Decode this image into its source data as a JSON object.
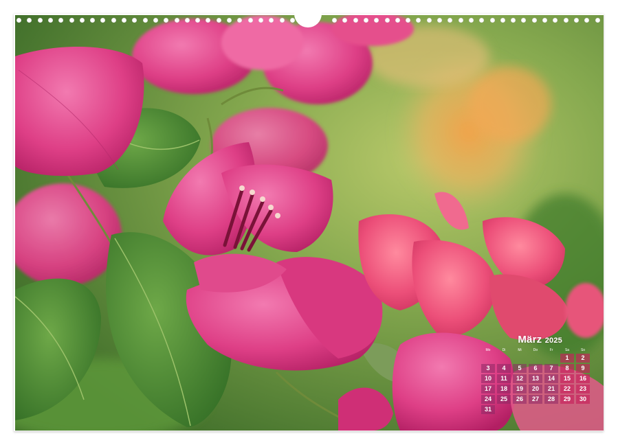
{
  "calendar": {
    "month": "März",
    "year": "2025",
    "weekday_headers": [
      "Mo",
      "Di",
      "Mi",
      "Do",
      "Fr",
      "Sa",
      "So"
    ],
    "weeks": [
      [
        "",
        "",
        "",
        "",
        "",
        "1",
        "2"
      ],
      [
        "3",
        "4",
        "5",
        "6",
        "7",
        "8",
        "9"
      ],
      [
        "10",
        "11",
        "12",
        "13",
        "14",
        "15",
        "16"
      ],
      [
        "17",
        "18",
        "19",
        "20",
        "21",
        "22",
        "23"
      ],
      [
        "24",
        "25",
        "26",
        "27",
        "28",
        "29",
        "30"
      ],
      [
        "31",
        "",
        "",
        "",
        "",
        "",
        ""
      ]
    ]
  },
  "colors": {
    "petal_magenta": "#d0357a",
    "petal_pink": "#e8508a",
    "leaf_green": "#4f8a34",
    "background_green": "#7ea853",
    "calendar_cell": "#8c2864",
    "calendar_weekend": "#c81e5a"
  }
}
